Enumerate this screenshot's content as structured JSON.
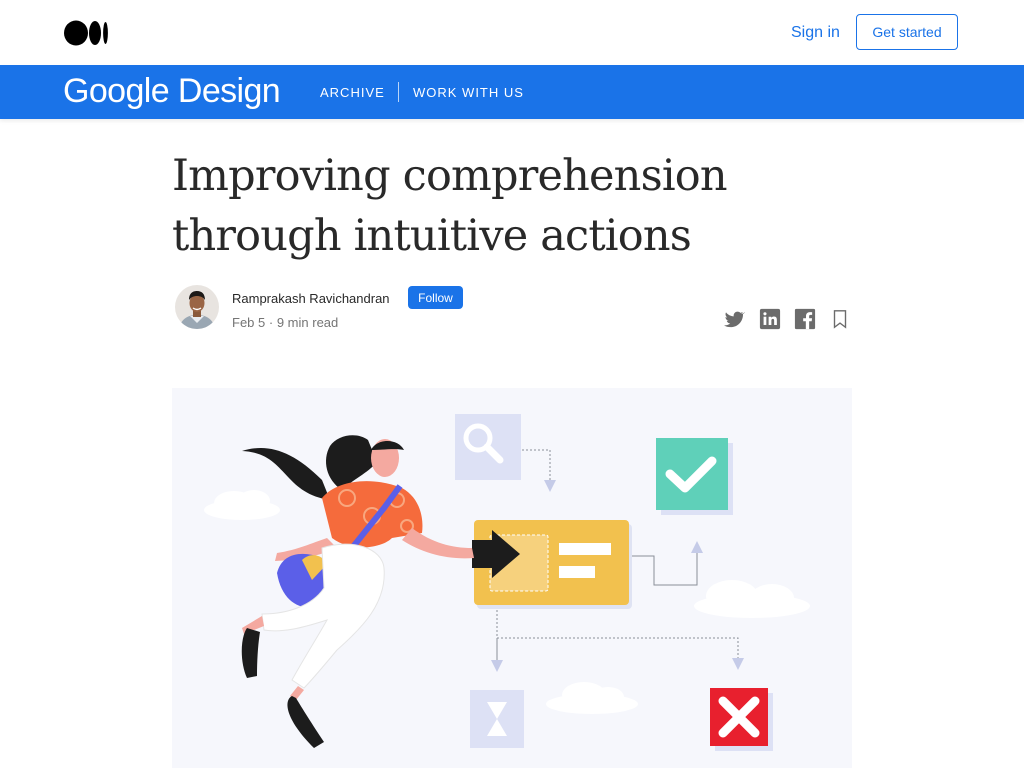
{
  "header": {
    "sign_in": "Sign in",
    "get_started": "Get started"
  },
  "publication": {
    "name": "Google Design",
    "nav": [
      "ARCHIVE",
      "WORK WITH US"
    ]
  },
  "article": {
    "title_line1": "Improving comprehension",
    "title_line2": "through intuitive actions",
    "author": "Ramprakash Ravichandran",
    "follow": "Follow",
    "date": "Feb 5",
    "separator": "·",
    "read_time": "9 min read"
  },
  "share_icons": [
    "twitter-icon",
    "linkedin-icon",
    "facebook-icon",
    "bookmark-icon"
  ],
  "colors": {
    "brand_blue": "#1a73e8",
    "title_text": "#292929",
    "meta_text": "#757575",
    "hero_bg": "#f6f7fc",
    "card_yellow": "#f2c14e",
    "check_green": "#5fd0b9",
    "error_red": "#e8202e",
    "purple": "#5b5fe8",
    "orange_shirt": "#f56b3c"
  }
}
